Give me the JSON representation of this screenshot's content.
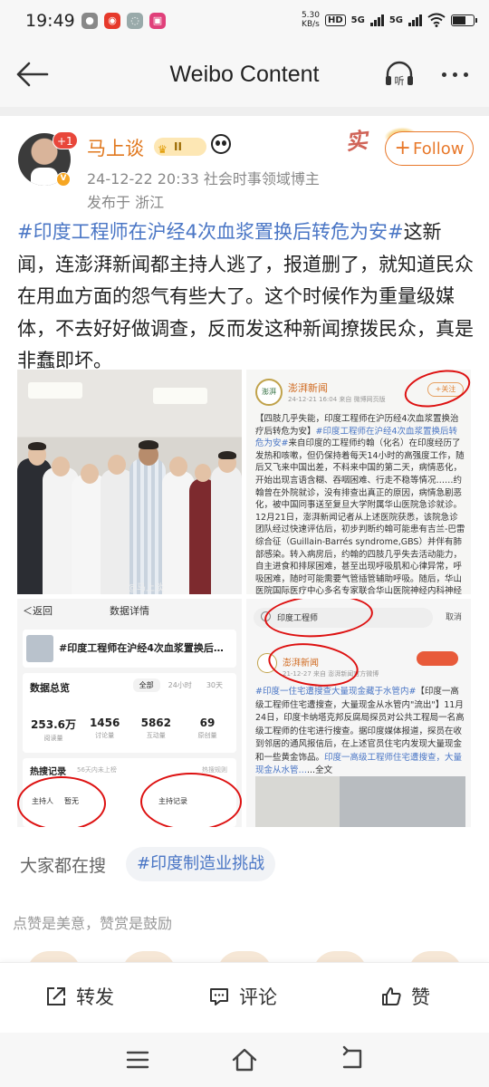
{
  "status_bar": {
    "time": "19:49",
    "net_speed_value": "5.30",
    "net_speed_unit": "KB/s",
    "hd": "HD",
    "sig1": "5G",
    "sig2": "5G",
    "apps": [
      "wechat-icon",
      "weibo-icon",
      "browser-icon",
      "vivo-icon"
    ]
  },
  "header": {
    "title": "Weibo Content",
    "listen_label": "听"
  },
  "author": {
    "name": "马上谈",
    "level": "II",
    "avatar_badge": "+1",
    "v_badge": "V",
    "datetime": "24-12-22 20:33",
    "description": "社会时事领域博主",
    "location": "发布于 浙江",
    "decoration_text": "实"
  },
  "follow": {
    "plus": "+",
    "label": "Follow"
  },
  "post": {
    "hashtag": "#印度工程师在沪经4次血浆置换后转危为安#",
    "text": "这新闻，连澎湃新闻都主持人逃了，报道删了，就知道民众在用血方面的怨气有些大了。这个时候作为重量级媒体，不去好好做调查，反而发这种新闻撩拨民众，真是非蠢即坏。"
  },
  "img1": {
    "watermark": "@马上谈"
  },
  "img2": {
    "account": "澎湃新闻",
    "account_avatar_text": "澎湃",
    "meta": "24-12-21 16:04 来自 微博网页版",
    "follow": "+关注",
    "lead": "【四肢几乎失能，印度工程师在沪历经4次血浆置换治疗后转危为安】",
    "hashtag": "#印度工程师在沪经4次血浆置换后转危为安#",
    "body": "来自印度的工程师约翰（化名）在印度经历了发热和咳嗽，但仍保持着每天14小时的高强度工作，随后又飞来中国出差，不料来中国的第二天，病情恶化，开始出现言语含糊、吞咽困难、行走不稳等情况……约翰曾在外院就诊，没有排查出真正的原因，病情急剧恶化，被中国同事送至复旦大学附属华山医院急诊就诊。12月21日，澎湃新闻记者从上述医院获悉，该院急诊团队经过快速评估后，初步判断约翰可能患有吉兰-巴雷综合征（Guillain-Barrés syndrome,GBS）并伴有肺部感染。转入病房后，约翰的四肢几乎失去活动能力，自主进食和排尿困难，甚至出现呼吸肌和心律异常，呼吸困难，随时可能需要气管插管辅助呼吸。随后，华山医院国际医疗中心多名专家联合华山医院神经内科神经免疫亚专业组"
  },
  "img3": {
    "back": "＜返回",
    "title": "数据详情",
    "card_title": "#印度工程师在沪经4次血浆置换后…",
    "overview": "数据总览",
    "tabs": [
      "全部",
      "24小时",
      "30天"
    ],
    "stats": [
      {
        "value": "253.6万",
        "label": "阅读量"
      },
      {
        "value": "1456",
        "label": "讨论量"
      },
      {
        "value": "5862",
        "label": "互动量"
      },
      {
        "value": "69",
        "label": "原创量"
      }
    ],
    "hot_title": "热搜记录",
    "hot_sub": "56天内未上榜",
    "hot_right": "热搜规则",
    "host_label": "主持人",
    "host_value": "暂无",
    "host_record": "主持记录"
  },
  "img4": {
    "search_text": "印度工程师",
    "cancel": "取消",
    "account": "澎湃新闻",
    "meta": "21-12-27 来自 澎湃新闻官方微博",
    "hashtag": "#印度一住宅遭搜查大量现金藏于水管内#",
    "body": "【印度一高级工程师住宅遭搜查，大量现金从水管内\"流出\"】11月24日，印度卡纳塔克邦反腐局探员对公共工程局一名高级工程师的住宅进行搜查。据印度媒体报道，探员在收到邻居的通风报信后，在上述官员住宅内发现大量现金和一些黄金饰品。",
    "link": "印度一高级工程师住宅遭搜查，大量现金从水管…",
    "more": "...全文"
  },
  "search_row": {
    "label": "大家都在搜",
    "tag": "#印度制造业挑战"
  },
  "likes_message": "点赞是美意，赞赏是鼓励",
  "actions": {
    "share": "转发",
    "comment": "评论",
    "like": "赞"
  },
  "colors": {
    "accent_orange": "#e8782a",
    "link_blue": "#4a76c5",
    "badge_red": "#e8473b"
  }
}
